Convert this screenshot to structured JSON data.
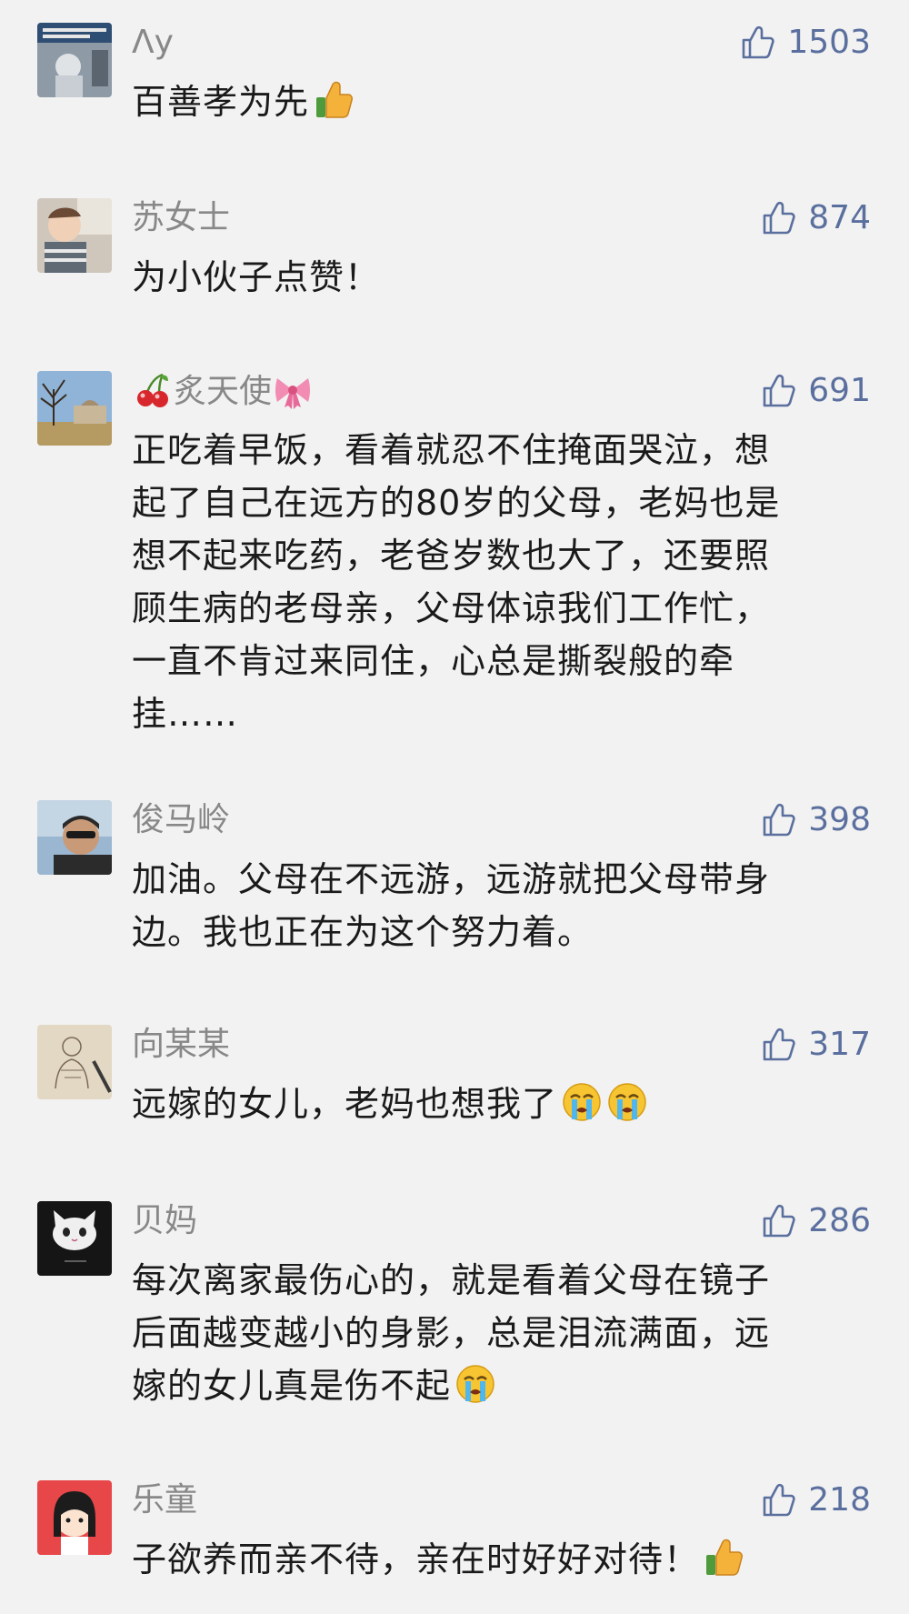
{
  "comments": [
    {
      "nickname": "Λy",
      "likes": "1503",
      "avatar": "poster-avatar",
      "lines": [
        "百善孝为先"
      ],
      "emoji": "thumbs-up-emoji"
    },
    {
      "nickname": "苏女士",
      "likes": "874",
      "avatar": "child-photo-avatar",
      "lines": [
        "为小伙子点赞！"
      ]
    },
    {
      "nickname": "炙天使",
      "likes": "691",
      "avatar": "campus-photo-avatar",
      "nick_prefix_emoji": "cherries-emoji",
      "nick_suffix_emoji": "ribbon-emoji",
      "lines": [
        "正吃着早饭，看着就忍不住掩面哭泣，想",
        "起了自己在远方的80岁的父母，老妈也是",
        "想不起来吃药，老爸岁数也大了，还要照",
        "顾生病的老母亲，父母体谅我们工作忙，",
        "一直不肯过来同住，心总是撕裂般的牵",
        "挂……"
      ]
    },
    {
      "nickname": "俊马岭",
      "likes": "398",
      "avatar": "man-sunglasses-avatar",
      "lines": [
        "加油。父母在不远游，远游就把父母带身",
        "边。我也正在为这个努力着。"
      ]
    },
    {
      "nickname": "向某某",
      "likes": "317",
      "avatar": "sketch-avatar",
      "lines": [
        "远嫁的女儿，老妈也想我了"
      ],
      "emoji_count": 2,
      "emoji": "loudly-crying-emoji"
    },
    {
      "nickname": "贝妈",
      "likes": "286",
      "avatar": "cat-avatar",
      "lines": [
        "每次离家最伤心的，就是看着父母在镜子",
        "后面越变越小的身影，总是泪流满面，远",
        "嫁的女儿真是伤不起"
      ],
      "emoji": "loudly-crying-emoji"
    },
    {
      "nickname": "乐童",
      "likes": "218",
      "avatar": "cartoon-girl-avatar",
      "lines": [
        "子欲养而亲不待，亲在时好好对待！"
      ],
      "emoji": "thumbs-up-emoji"
    }
  ],
  "colors": {
    "background": "#f2f2f2",
    "nickname": "#888888",
    "like": "#5a6f9e",
    "text": "#1a1a1a"
  }
}
